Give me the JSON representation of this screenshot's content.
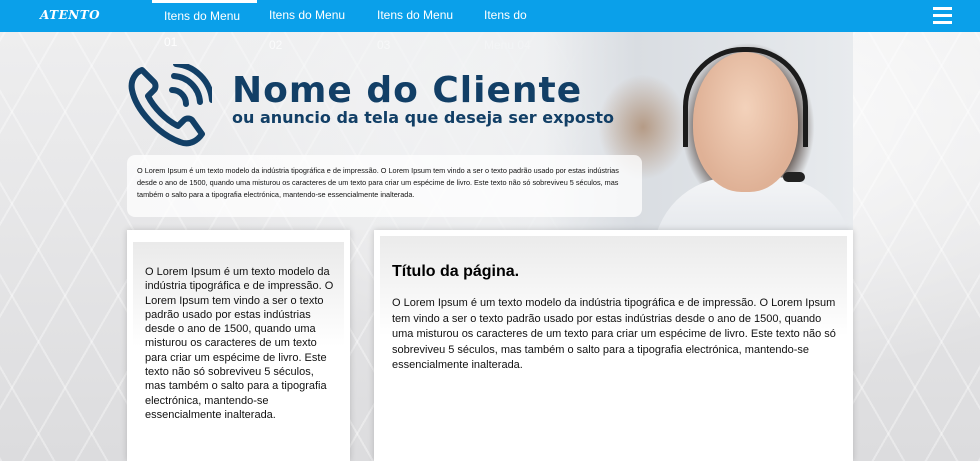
{
  "brand": {
    "logo_text": "ATENTO"
  },
  "colors": {
    "topbar": "#0aa0ea",
    "title": "#123f66"
  },
  "nav": {
    "items": [
      {
        "label": "Itens do Menu 01",
        "active": true
      },
      {
        "label": "Itens do Menu 02",
        "active": false
      },
      {
        "label": "Itens do Menu 03",
        "active": false
      },
      {
        "label": "Itens do Menu 04",
        "active": false
      }
    ],
    "menu_icon": "hamburger-icon"
  },
  "hero": {
    "title": "Nome do Cliente",
    "subtitle": "ou anuncio da tela que deseja ser exposto",
    "icon": "phone-icon",
    "text": "O Lorem Ipsum é um texto modelo da indústria tipográfica e de impressão. O Lorem Ipsum tem vindo a ser o texto padrão usado por estas indústrias desde o ano de 1500, quando uma misturou os caracteres de um texto para criar um espécime de livro. Este texto não só sobreviveu 5 séculos, mas também o salto para a tipografia electrónica, mantendo-se essencialmente inalterada."
  },
  "sidebar": {
    "text": "O Lorem Ipsum é um texto modelo da indústria tipográfica e de impressão. O Lorem Ipsum tem vindo a ser o texto padrão usado por estas indústrias desde o ano de 1500, quando uma misturou os caracteres de um texto para criar um espécime de livro. Este texto não só sobreviveu 5 séculos, mas também o salto para a tipografia electrónica, mantendo-se essencialmente inalterada."
  },
  "main": {
    "title": "Título da página.",
    "text": "O Lorem Ipsum é um texto modelo da indústria tipográfica e de impressão. O Lorem Ipsum tem vindo a ser o texto padrão usado por estas indústrias desde o ano de 1500, quando uma misturou os caracteres de um texto para criar um espécime de livro. Este texto não só sobreviveu 5 séculos, mas também o salto para a tipografia electrónica, mantendo-se essencialmente inalterada."
  }
}
